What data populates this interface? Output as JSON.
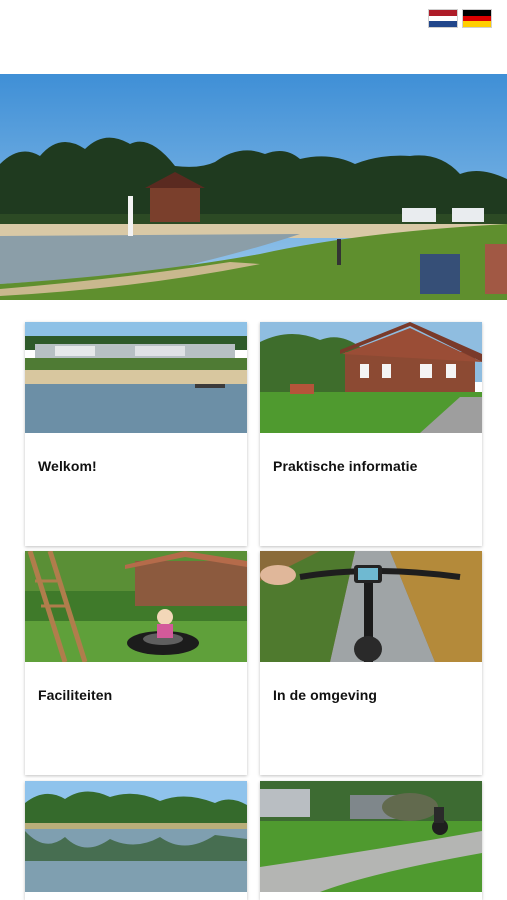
{
  "header": {
    "languages": [
      {
        "name": "nl-flag-icon",
        "colors": [
          "#ae1c28",
          "#ffffff",
          "#21468b"
        ]
      },
      {
        "name": "de-flag-icon",
        "colors": [
          "#000000",
          "#dd0000",
          "#ffce00"
        ]
      }
    ]
  },
  "carousel": {
    "slide_count": 8,
    "active_index": 0,
    "next_icon": "arrow-right-circle-icon"
  },
  "cards": [
    {
      "label": "Welkom!",
      "image": "lake-beach-campers-photo"
    },
    {
      "label": "Praktische informatie",
      "image": "brick-farmhouse-photo"
    },
    {
      "label": "Faciliteiten",
      "image": "playground-swing-photo"
    },
    {
      "label": "In de omgeving",
      "image": "e-bike-path-photo"
    },
    {
      "label": "",
      "image": "lake-reflection-photo"
    },
    {
      "label": "",
      "image": "campsite-caravans-photo"
    }
  ]
}
